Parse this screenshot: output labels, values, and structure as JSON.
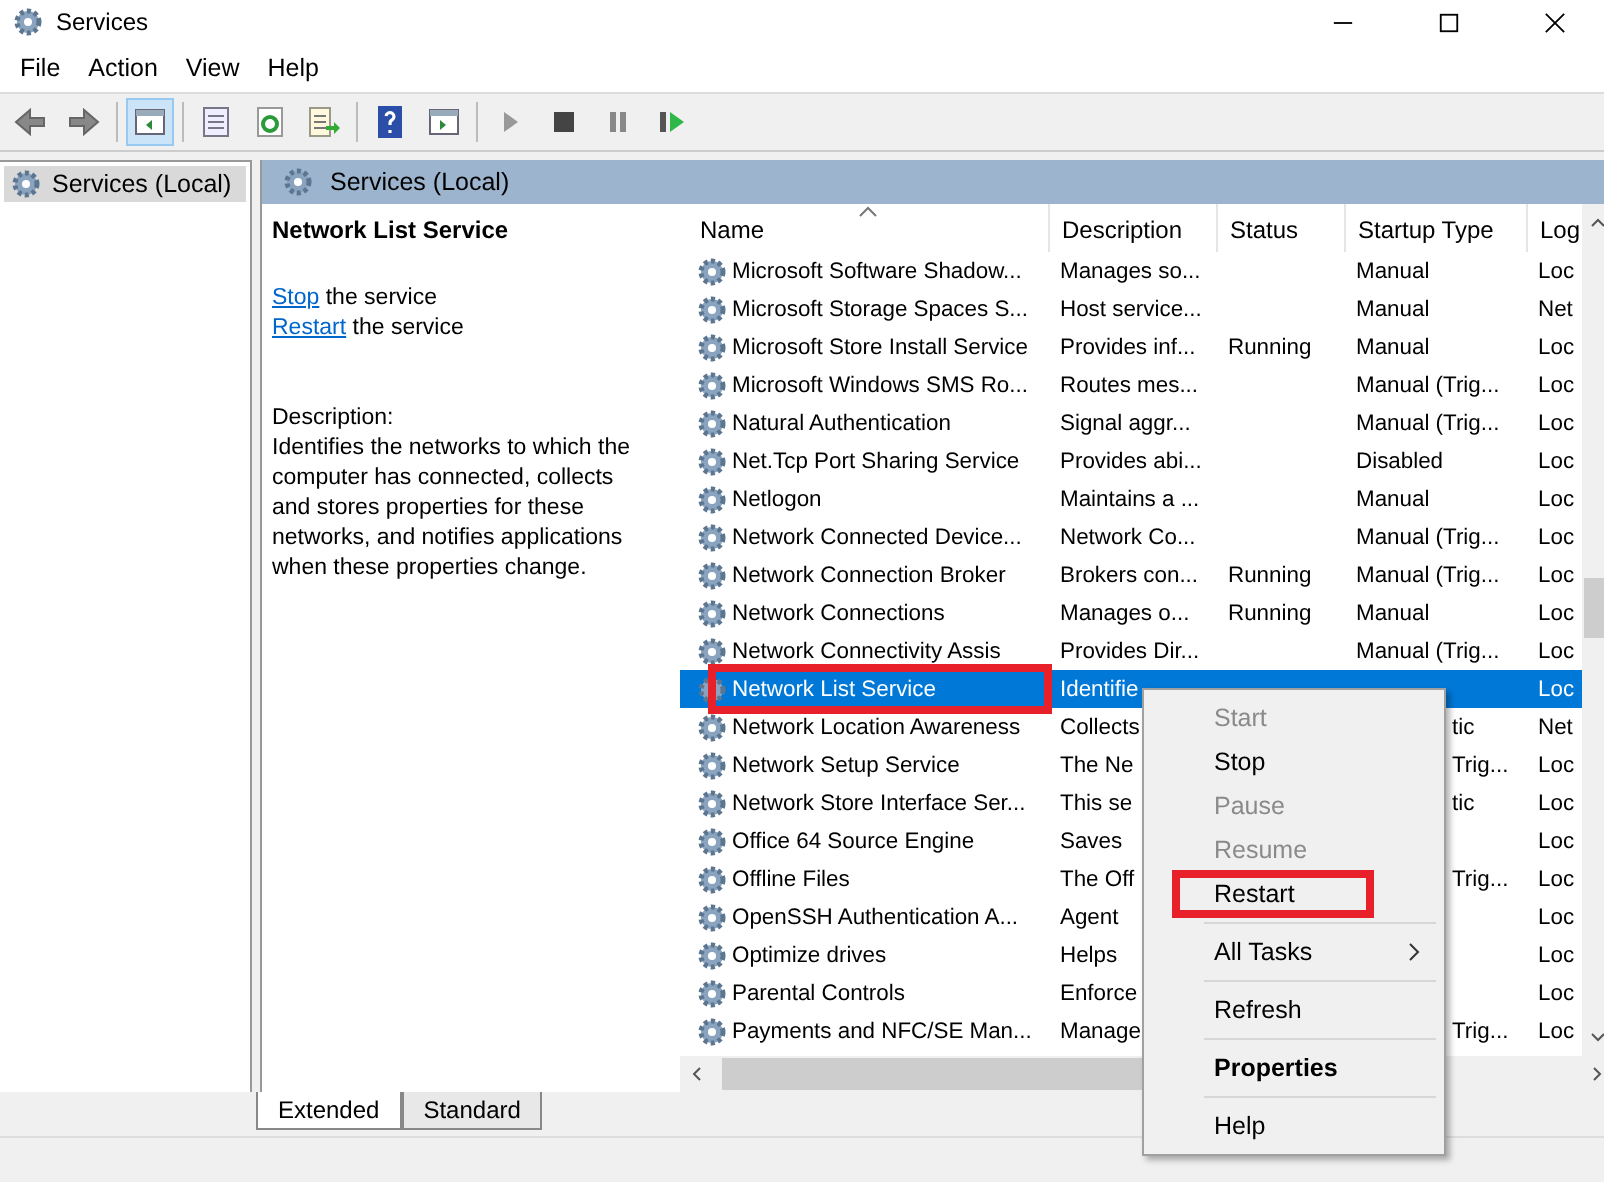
{
  "window": {
    "title": "Services"
  },
  "menu_bar": [
    "File",
    "Action",
    "View",
    "Help"
  ],
  "tree": [
    {
      "label": "Services (Local)",
      "selected": true
    }
  ],
  "pane_title": "Services (Local)",
  "extended": {
    "title": "Network List Service",
    "actions": [
      {
        "link": "Stop",
        "rest": "the service"
      },
      {
        "link": "Restart",
        "rest": "the service"
      }
    ],
    "description_label": "Description:",
    "description": "Identifies the networks to which the computer has connected, collects and stores properties for these networks, and notifies applications when these properties change."
  },
  "table": {
    "columns": [
      "Name",
      "Description",
      "Status",
      "Startup Type",
      "Log"
    ],
    "rows": [
      {
        "name": "Microsoft Software Shadow...",
        "description": "Manages so...",
        "startup": "Manual",
        "log_on": "Loc",
        "selected": false
      },
      {
        "name": "Microsoft Storage Spaces S...",
        "description": "Host service...",
        "startup": "Manual",
        "log_on": "Net",
        "selected": false
      },
      {
        "name": "Microsoft Store Install Service",
        "description": "Provides inf...",
        "status": "Running",
        "startup": "Manual",
        "log_on": "Loc",
        "selected": false
      },
      {
        "name": "Microsoft Windows SMS Ro...",
        "description": "Routes mes...",
        "startup": "Manual (Trig...",
        "log_on": "Loc",
        "selected": false
      },
      {
        "name": "Natural Authentication",
        "description": "Signal aggr...",
        "startup": "Manual (Trig...",
        "log_on": "Loc",
        "selected": false
      },
      {
        "name": "Net.Tcp Port Sharing Service",
        "description": "Provides abi...",
        "startup": "Disabled",
        "log_on": "Loc",
        "selected": false
      },
      {
        "name": "Netlogon",
        "description": "Maintains a ...",
        "startup": "Manual",
        "log_on": "Loc",
        "selected": false
      },
      {
        "name": "Network Connected Device...",
        "description": "Network Co...",
        "startup": "Manual (Trig...",
        "log_on": "Loc",
        "selected": false
      },
      {
        "name": "Network Connection Broker",
        "description": "Brokers con...",
        "status": "Running",
        "startup": "Manual (Trig...",
        "log_on": "Loc",
        "selected": false
      },
      {
        "name": "Network Connections",
        "description": "Manages o...",
        "status": "Running",
        "startup": "Manual",
        "log_on": "Loc",
        "selected": false
      },
      {
        "name": "Network Connectivity Assis",
        "description": "Provides Dir...",
        "startup": "Manual (Trig...",
        "log_on": "Loc",
        "selected": false
      },
      {
        "name": "Network List Service",
        "description": "Identifie",
        "log_on": "Loc",
        "selected": true,
        "annotated": true
      },
      {
        "name": "Network Location Awareness",
        "description": "Collects",
        "startup": "tic",
        "startup_partial": true,
        "log_on": "Net",
        "selected": false
      },
      {
        "name": "Network Setup Service",
        "description": "The Ne",
        "startup": "Trig...",
        "startup_partial": true,
        "log_on": "Loc",
        "selected": false
      },
      {
        "name": "Network Store Interface Ser...",
        "description": "This se",
        "startup": "tic",
        "startup_partial": true,
        "log_on": "Loc",
        "selected": false
      },
      {
        "name": "Office 64 Source Engine",
        "description": "Saves",
        "log_on": "Loc",
        "selected": false
      },
      {
        "name": "Offline Files",
        "description": "The Off",
        "startup": "Trig...",
        "startup_partial": true,
        "log_on": "Loc",
        "selected": false
      },
      {
        "name": "OpenSSH Authentication A...",
        "description": "Agent",
        "log_on": "Loc",
        "selected": false
      },
      {
        "name": "Optimize drives",
        "description": "Helps",
        "log_on": "Loc",
        "selected": false
      },
      {
        "name": "Parental Controls",
        "description": "Enforce",
        "log_on": "Loc",
        "selected": false
      },
      {
        "name": "Payments and NFC/SE Man...",
        "description": "Manage",
        "startup": "Trig...",
        "startup_partial": true,
        "log_on": "Loc",
        "selected": false
      }
    ]
  },
  "context_menu": [
    {
      "kind": "item",
      "label": "Start",
      "disabled": true
    },
    {
      "kind": "item",
      "label": "Stop",
      "disabled": false
    },
    {
      "kind": "item",
      "label": "Pause",
      "disabled": true
    },
    {
      "kind": "item",
      "label": "Resume",
      "disabled": true
    },
    {
      "kind": "item",
      "label": "Restart",
      "disabled": false,
      "annotated": true
    },
    {
      "kind": "separator"
    },
    {
      "kind": "item",
      "label": "All Tasks",
      "disabled": false,
      "submenu": true
    },
    {
      "kind": "separator"
    },
    {
      "kind": "item",
      "label": "Refresh",
      "disabled": false
    },
    {
      "kind": "separator"
    },
    {
      "kind": "item",
      "label": "Properties",
      "disabled": false,
      "bold": true
    },
    {
      "kind": "separator"
    },
    {
      "kind": "item",
      "label": "Help",
      "disabled": false
    }
  ],
  "tabs": [
    {
      "label": "Extended",
      "selected": true
    },
    {
      "label": "Standard",
      "selected": false
    }
  ]
}
